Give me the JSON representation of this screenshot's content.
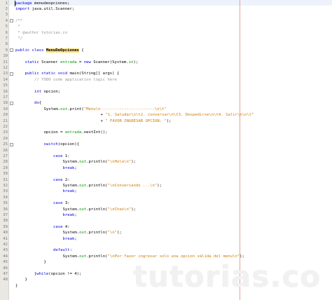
{
  "editor": {
    "watermark": "tutorias.co",
    "line_numbers": [
      "1",
      "2",
      "3",
      "4",
      "5",
      "6",
      "7",
      "8",
      "9",
      "10",
      "11",
      "12",
      "13",
      "14",
      "15",
      "16",
      "17",
      "18",
      "19",
      "20",
      "21",
      "22",
      "23",
      "24",
      "25",
      "26",
      "27",
      "28",
      "29",
      "30",
      "31",
      "32",
      "33",
      "34",
      "35",
      "36",
      "37",
      "38",
      "39",
      "40",
      "41",
      "42",
      "43",
      "44",
      "45",
      "46",
      "47",
      "48"
    ],
    "lines": [
      {
        "indent": 0,
        "segments": [
          {
            "t": "package",
            "c": "kw"
          },
          {
            "t": " menudeopciones;",
            "c": ""
          }
        ]
      },
      {
        "indent": 0,
        "segments": [
          {
            "t": "import",
            "c": "kw"
          },
          {
            "t": " java.util.Scanner;",
            "c": ""
          }
        ]
      },
      {
        "indent": 0,
        "segments": []
      },
      {
        "indent": 0,
        "segments": [
          {
            "t": "/**",
            "c": "cmt"
          }
        ]
      },
      {
        "indent": 0,
        "segments": [
          {
            "t": " *",
            "c": "cmt"
          }
        ]
      },
      {
        "indent": 0,
        "segments": [
          {
            "t": " * @author tutorias.co",
            "c": "cmt"
          }
        ]
      },
      {
        "indent": 0,
        "segments": [
          {
            "t": " */",
            "c": "cmt"
          }
        ]
      },
      {
        "indent": 0,
        "segments": []
      },
      {
        "indent": 0,
        "segments": [
          {
            "t": "public class ",
            "c": "kw"
          },
          {
            "t": "MenuDeOpciones",
            "c": "hl"
          },
          {
            "t": " {",
            "c": ""
          }
        ]
      },
      {
        "indent": 0,
        "segments": []
      },
      {
        "indent": 1,
        "segments": [
          {
            "t": "static",
            "c": "kw"
          },
          {
            "t": " Scanner ",
            "c": ""
          },
          {
            "t": "entrada",
            "c": "fld"
          },
          {
            "t": " = ",
            "c": ""
          },
          {
            "t": "new",
            "c": "kw"
          },
          {
            "t": " Scanner(System.",
            "c": ""
          },
          {
            "t": "in",
            "c": "fld"
          },
          {
            "t": ");",
            "c": ""
          }
        ]
      },
      {
        "indent": 0,
        "segments": []
      },
      {
        "indent": 1,
        "segments": [
          {
            "t": "public static void",
            "c": "kw"
          },
          {
            "t": " main(String[] args) {",
            "c": ""
          }
        ]
      },
      {
        "indent": 2,
        "segments": [
          {
            "t": "// TODO code application logic here",
            "c": "cmt"
          }
        ]
      },
      {
        "indent": 0,
        "segments": []
      },
      {
        "indent": 2,
        "segments": [
          {
            "t": "int",
            "c": "kw"
          },
          {
            "t": " opcion;",
            "c": ""
          }
        ]
      },
      {
        "indent": 0,
        "segments": []
      },
      {
        "indent": 2,
        "segments": [
          {
            "t": "do",
            "c": "kw"
          },
          {
            "t": "{",
            "c": ""
          }
        ]
      },
      {
        "indent": 3,
        "segments": [
          {
            "t": "System.",
            "c": ""
          },
          {
            "t": "out",
            "c": "fld"
          },
          {
            "t": ".print(",
            "c": ""
          },
          {
            "t": "\"Menu\\n-----------------------\\n\\t\"",
            "c": "str"
          }
        ]
      },
      {
        "indent": 9,
        "segments": [
          {
            "t": "+ ",
            "c": ""
          },
          {
            "t": "\"1. Saludar\\n\\t2. conversar\\n\\t3. Despedirse\\n\\t4. Salir\\n\\n\\t\"",
            "c": "str"
          }
        ]
      },
      {
        "indent": 9,
        "segments": [
          {
            "t": "+ ",
            "c": ""
          },
          {
            "t": "\" FAVOR INGRESAR OPCION: \"",
            "c": "str"
          },
          {
            "t": ");",
            "c": ""
          }
        ]
      },
      {
        "indent": 0,
        "segments": []
      },
      {
        "indent": 3,
        "segments": [
          {
            "t": "opcion = ",
            "c": ""
          },
          {
            "t": "entrada",
            "c": "fld"
          },
          {
            "t": ".nextInt();",
            "c": ""
          }
        ]
      },
      {
        "indent": 0,
        "segments": []
      },
      {
        "indent": 3,
        "segments": [
          {
            "t": "switch",
            "c": "kw"
          },
          {
            "t": "(opcion){",
            "c": ""
          }
        ]
      },
      {
        "indent": 0,
        "segments": []
      },
      {
        "indent": 4,
        "segments": [
          {
            "t": "case",
            "c": "kw"
          },
          {
            "t": " 1:",
            "c": ""
          }
        ]
      },
      {
        "indent": 5,
        "segments": [
          {
            "t": "System.",
            "c": ""
          },
          {
            "t": "out",
            "c": "fld"
          },
          {
            "t": ".println(",
            "c": ""
          },
          {
            "t": "\"\\nHola\\n\"",
            "c": "str"
          },
          {
            "t": ");",
            "c": ""
          }
        ]
      },
      {
        "indent": 5,
        "segments": [
          {
            "t": "break",
            "c": "kw"
          },
          {
            "t": ";",
            "c": ""
          }
        ]
      },
      {
        "indent": 0,
        "segments": []
      },
      {
        "indent": 4,
        "segments": [
          {
            "t": "case",
            "c": "kw"
          },
          {
            "t": " 2:",
            "c": ""
          }
        ]
      },
      {
        "indent": 5,
        "segments": [
          {
            "t": "System.",
            "c": ""
          },
          {
            "t": "out",
            "c": "fld"
          },
          {
            "t": ".println(",
            "c": ""
          },
          {
            "t": "\"\\nConversando ...\\n\"",
            "c": "str"
          },
          {
            "t": ");",
            "c": ""
          }
        ]
      },
      {
        "indent": 5,
        "segments": [
          {
            "t": "break",
            "c": "kw"
          },
          {
            "t": ";",
            "c": ""
          }
        ]
      },
      {
        "indent": 0,
        "segments": []
      },
      {
        "indent": 4,
        "segments": [
          {
            "t": "case",
            "c": "kw"
          },
          {
            "t": " 3:",
            "c": ""
          }
        ]
      },
      {
        "indent": 5,
        "segments": [
          {
            "t": "System.",
            "c": ""
          },
          {
            "t": "out",
            "c": "fld"
          },
          {
            "t": ".println(",
            "c": ""
          },
          {
            "t": "\"\\nChao\\n\"",
            "c": "str"
          },
          {
            "t": ");",
            "c": ""
          }
        ]
      },
      {
        "indent": 5,
        "segments": [
          {
            "t": "break",
            "c": "kw"
          },
          {
            "t": ";",
            "c": ""
          }
        ]
      },
      {
        "indent": 0,
        "segments": []
      },
      {
        "indent": 4,
        "segments": [
          {
            "t": "case",
            "c": "kw"
          },
          {
            "t": " 4:",
            "c": ""
          }
        ]
      },
      {
        "indent": 5,
        "segments": [
          {
            "t": "System.",
            "c": ""
          },
          {
            "t": "out",
            "c": "fld"
          },
          {
            "t": ".println(",
            "c": ""
          },
          {
            "t": "\"\\n\"",
            "c": "str"
          },
          {
            "t": ");",
            "c": ""
          }
        ]
      },
      {
        "indent": 5,
        "segments": [
          {
            "t": "break",
            "c": "kw"
          },
          {
            "t": ";",
            "c": ""
          }
        ]
      },
      {
        "indent": 0,
        "segments": []
      },
      {
        "indent": 4,
        "segments": [
          {
            "t": "default",
            "c": "kw"
          },
          {
            "t": ":",
            "c": ""
          }
        ]
      },
      {
        "indent": 5,
        "segments": [
          {
            "t": "System.",
            "c": ""
          },
          {
            "t": "out",
            "c": "fld"
          },
          {
            "t": ".println(",
            "c": ""
          },
          {
            "t": "\"\\nPor favor ingresar solo una opcion válida del menu\\n\"",
            "c": "str"
          },
          {
            "t": ");",
            "c": ""
          }
        ]
      },
      {
        "indent": 3,
        "segments": [
          {
            "t": "}",
            "c": ""
          }
        ]
      },
      {
        "indent": 0,
        "segments": []
      },
      {
        "indent": 2,
        "segments": [
          {
            "t": "}",
            "c": ""
          },
          {
            "t": "while",
            "c": "kw"
          },
          {
            "t": "(opcion != 4);",
            "c": ""
          }
        ]
      },
      {
        "indent": 1,
        "segments": [
          {
            "t": "}",
            "c": ""
          }
        ]
      },
      {
        "indent": 0,
        "segments": [
          {
            "t": "}",
            "c": ""
          }
        ]
      }
    ],
    "folds": [
      4,
      9,
      13,
      18,
      25
    ]
  }
}
